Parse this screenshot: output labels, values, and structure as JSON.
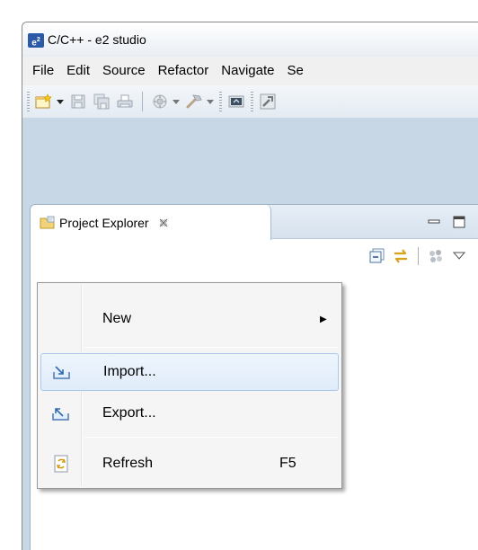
{
  "window": {
    "title": "C/C++ - e2 studio",
    "app_icon_text": "e",
    "app_icon_sup": "2"
  },
  "menubar": {
    "items": [
      "File",
      "Edit",
      "Source",
      "Refactor",
      "Navigate",
      "Se"
    ]
  },
  "toolbar": {
    "icons": [
      "new-wizard-icon",
      "save-icon",
      "save-all-icon",
      "print-icon",
      "build-icon",
      "hammer-icon",
      "debug-config-icon",
      "tools-icon"
    ]
  },
  "project_explorer": {
    "tab_label": "Project Explorer",
    "tab_close_glyph": "✕",
    "view_toolbar_icons": [
      "collapse-all-icon",
      "link-with-editor-icon",
      "focus-icon",
      "view-menu-icon"
    ]
  },
  "context_menu": {
    "items": [
      {
        "label": "New",
        "has_submenu": true,
        "accel": "",
        "icon": ""
      },
      {
        "label": "Import...",
        "has_submenu": false,
        "accel": "",
        "icon": "import-icon",
        "highlighted": true
      },
      {
        "label": "Export...",
        "has_submenu": false,
        "accel": "",
        "icon": "export-icon"
      },
      {
        "label": "Refresh",
        "has_submenu": false,
        "accel": "F5",
        "icon": "refresh-icon"
      }
    ],
    "submenu_arrow": "▶"
  },
  "colors": {
    "window_bg": "#c8d7e6",
    "menu_bg": "#f5f5f5",
    "highlight_border": "#a8c8ec",
    "app_icon": "#2b5aa7"
  }
}
